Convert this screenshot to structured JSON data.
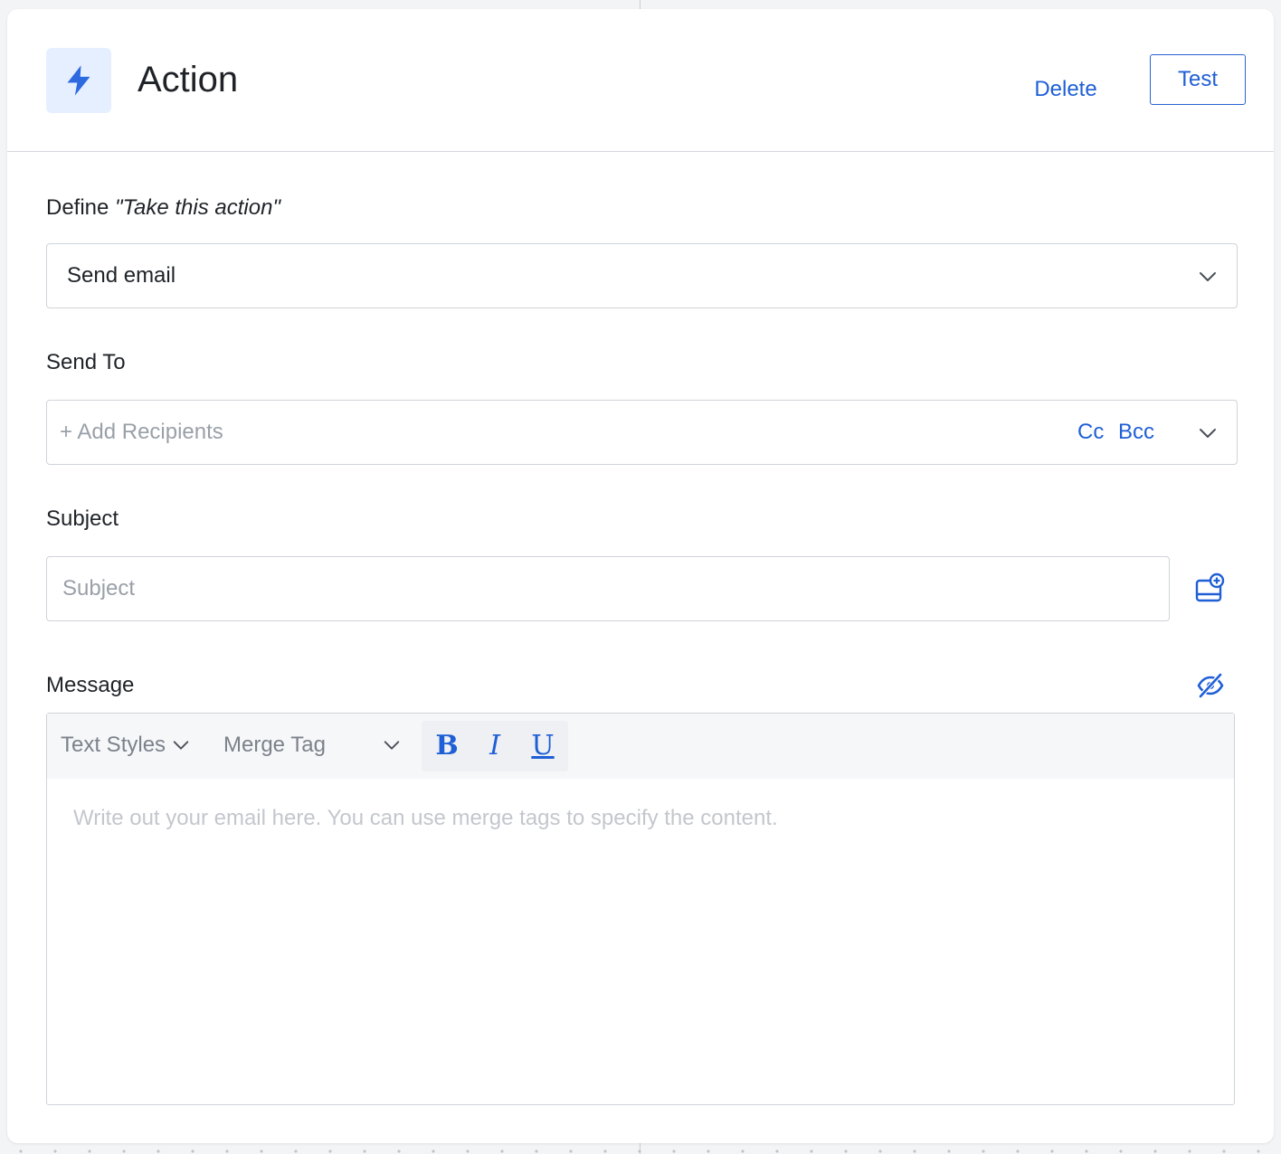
{
  "header": {
    "title": "Action",
    "icon": "lightning-bolt-icon",
    "delete_label": "Delete",
    "test_label": "Test"
  },
  "define": {
    "label_prefix": "Define ",
    "label_emphasis": "\"Take this action\"",
    "selected_value": "Send email"
  },
  "send_to": {
    "label": "Send To",
    "placeholder": "+ Add Recipients",
    "cc_label": "Cc",
    "bcc_label": "Bcc"
  },
  "subject": {
    "label": "Subject",
    "placeholder": "Subject",
    "value": ""
  },
  "message": {
    "label": "Message",
    "toolbar": {
      "text_styles": "Text Styles",
      "merge_tag": "Merge Tag",
      "bold": "B",
      "italic": "I",
      "underline": "U"
    },
    "placeholder": "Write out your email here. You can use merge tags to specify the content."
  },
  "colors": {
    "accent": "#1f5fd6",
    "icon_bg": "#e6efff",
    "border": "#cfd3d8",
    "placeholder": "#9aa0a8"
  }
}
